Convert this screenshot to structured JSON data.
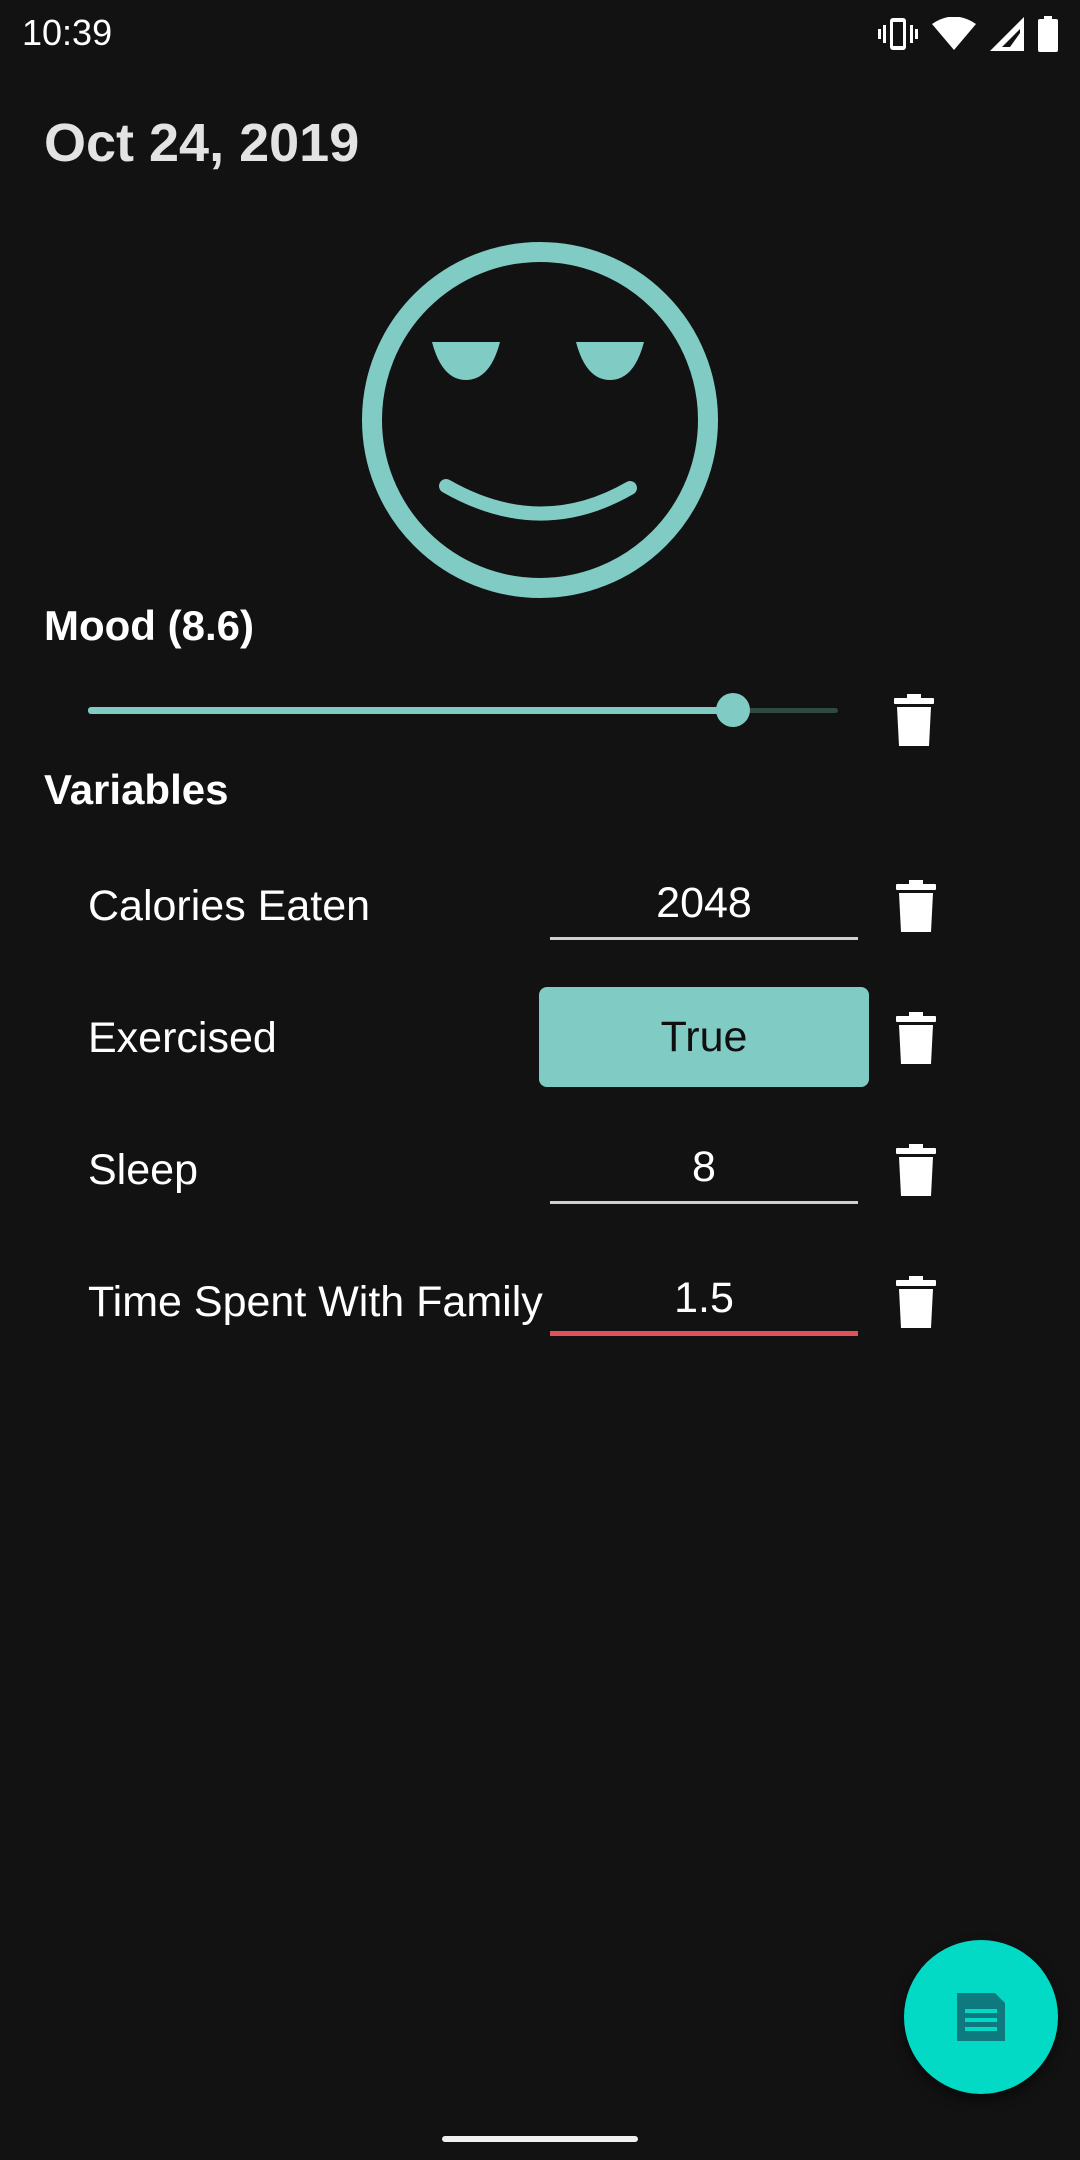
{
  "status_bar": {
    "time": "10:39",
    "icons": [
      "vibrate-icon",
      "wifi-icon",
      "cellular-signal-icon",
      "battery-icon"
    ]
  },
  "date": "Oct 24, 2019",
  "mood": {
    "label": "Mood (8.6)",
    "value": 8.6,
    "slider_fraction": 0.86,
    "face_icon": "content-smiley-face-icon",
    "delete_icon": "trash-icon"
  },
  "variables": {
    "label": "Variables",
    "items": [
      {
        "name": "Calories Eaten",
        "type": "number",
        "value": "2048"
      },
      {
        "name": "Exercised",
        "type": "boolean",
        "value": "True"
      },
      {
        "name": "Sleep",
        "type": "number",
        "value": "8"
      },
      {
        "name": "Time Spent With Family",
        "type": "number",
        "value": "1.5",
        "focused": true
      }
    ]
  },
  "fab": {
    "icon": "save-floppy-icon"
  },
  "colors": {
    "background": "#121212",
    "accent": "#80cbc4",
    "fab": "#03dac5",
    "error_underline": "#e05257",
    "date_text": "#e3e3e3"
  }
}
